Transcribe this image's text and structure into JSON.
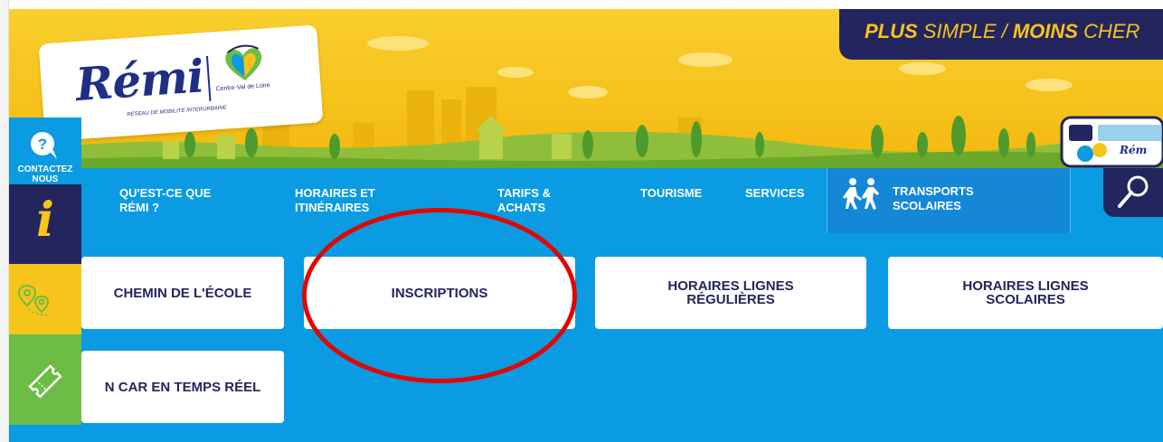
{
  "colors": {
    "banner_yellow": "#f7c41b",
    "nav_blue": "#0a9be2",
    "navy": "#23255e",
    "green": "#6cbd45",
    "annotation_red": "#e10600"
  },
  "logo": {
    "wordmark": "Rémi",
    "region": "Centre-Val de Loire",
    "tagline": "RÉSEAU DE MOBILITÉ INTERURBAINE"
  },
  "slogan": {
    "part1": "PLUS",
    "part2": " SIMPLE / ",
    "part3": "MOINS",
    "part4": " CHER"
  },
  "nav": {
    "items": [
      {
        "label": "QU'EST-CE QUE RÉMI ?"
      },
      {
        "label": "HORAIRES ET ITINÉRAIRES"
      },
      {
        "label": "TARIFS & ACHATS"
      },
      {
        "label": "TOURISME"
      },
      {
        "label": "SERVICES"
      },
      {
        "label": "TRANSPORTS SCOLAIRES",
        "icon": "children-walking-icon"
      }
    ],
    "search_icon": "search-icon"
  },
  "side_rail": {
    "contact_label": "CONTACTEZ NOUS",
    "contact_icon": "help-chat-icon",
    "info_icon": "info-icon",
    "map_icon": "map-pins-icon",
    "ticket_icon": "ticket-icon"
  },
  "cards": [
    {
      "label": "CHEMIN DE L'ÉCOLE"
    },
    {
      "label": "INSCRIPTIONS"
    },
    {
      "label1": "HORAIRES LIGNES",
      "label2": "RÉGULIÈRES"
    },
    {
      "label1": "HORAIRES LIGNES",
      "label2": "SCOLAIRES"
    },
    {
      "label": "N CAR EN TEMPS RÉEL"
    }
  ]
}
